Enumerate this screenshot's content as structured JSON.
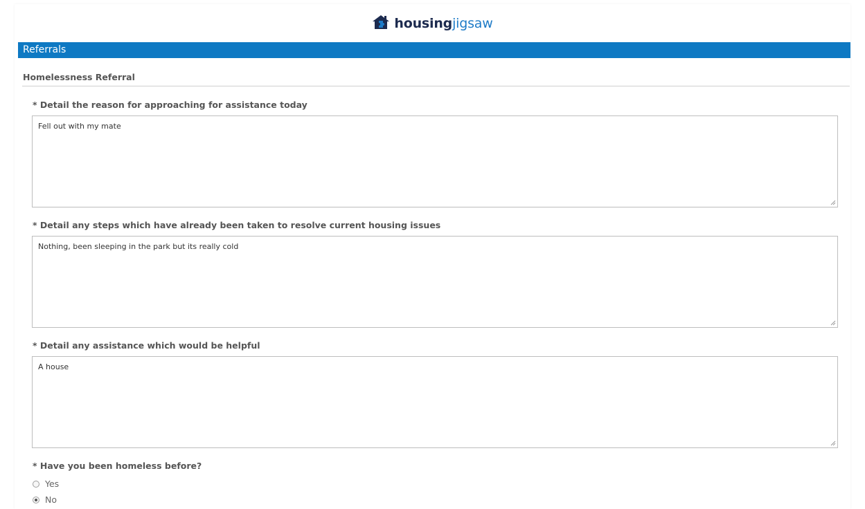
{
  "header": {
    "logo_bold": "housing",
    "logo_light": "jigsaw",
    "logo_icon": "house-puzzle-icon"
  },
  "section": {
    "title": "Referrals",
    "subtitle": "Homelessness Referral"
  },
  "questions": [
    {
      "label": "* Detail the reason for approaching for assistance today",
      "value": "Fell out with my mate"
    },
    {
      "label": "* Detail any steps which have already been taken to resolve current housing issues",
      "value": "Nothing, been sleeping in the park but its really cold"
    },
    {
      "label": "* Detail any assistance which would be helpful",
      "value": "A house"
    }
  ],
  "homeless_before": {
    "label": "* Have you been homeless before?",
    "options": [
      {
        "label": "Yes",
        "selected": false
      },
      {
        "label": "No",
        "selected": true
      }
    ]
  },
  "colors": {
    "brand_blue": "#0e79c3",
    "logo_dark": "#1d2b4f"
  }
}
